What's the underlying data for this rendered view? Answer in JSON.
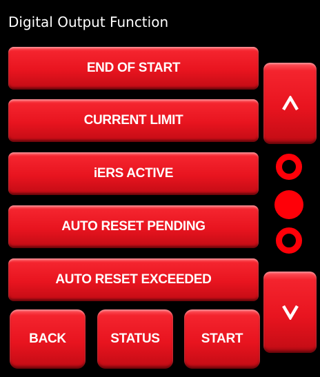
{
  "header": {
    "title": "Digital Output Function"
  },
  "function_list": {
    "items": [
      {
        "label": "END OF START"
      },
      {
        "label": "CURRENT LIMIT"
      },
      {
        "label": "iERS ACTIVE"
      },
      {
        "label": "AUTO RESET PENDING"
      },
      {
        "label": "AUTO RESET EXCEEDED"
      }
    ]
  },
  "navigation": {
    "back_label": "BACK",
    "status_label": "STATUS",
    "start_label": "START"
  },
  "scroll": {
    "up_icon": "chevron-up-icon",
    "down_icon": "chevron-down-icon",
    "page_indicator": {
      "pages": 3,
      "current_page": 2
    }
  },
  "colors": {
    "background": "#000000",
    "button_red": "#e8141f",
    "indicator_red": "#ff0008",
    "text": "#ffffff"
  }
}
